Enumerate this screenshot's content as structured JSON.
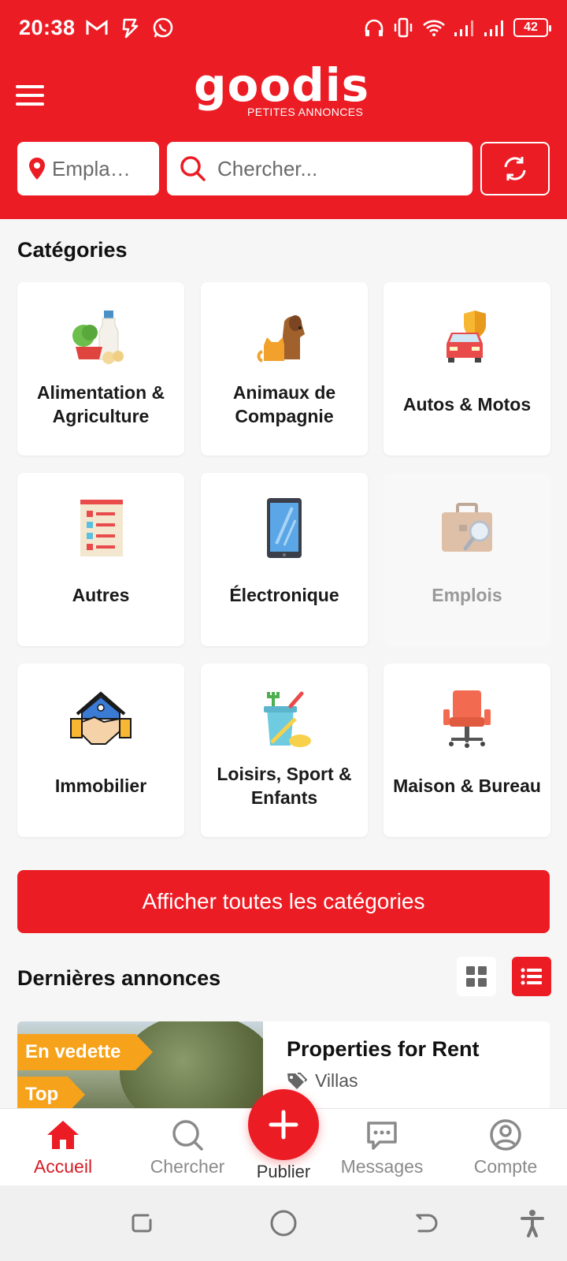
{
  "status_bar": {
    "time": "20:38",
    "battery": "42"
  },
  "header": {
    "logo_text": "goodis",
    "logo_subtitle": "PETITES ANNONCES"
  },
  "search": {
    "location_placeholder": "Empla…",
    "query_placeholder": "Chercher..."
  },
  "categories": {
    "title": "Catégories",
    "items": [
      {
        "label": "Alimentation & Agriculture",
        "icon": "food-icon"
      },
      {
        "label": "Animaux de Compagnie",
        "icon": "pets-icon"
      },
      {
        "label": "Autos & Motos",
        "icon": "car-icon"
      },
      {
        "label": "Autres",
        "icon": "list-icon"
      },
      {
        "label": "Électronique",
        "icon": "phone-icon"
      },
      {
        "label": "Emplois",
        "icon": "briefcase-icon"
      },
      {
        "label": "Immobilier",
        "icon": "house-handshake-icon"
      },
      {
        "label": "Loisirs, Sport & Enfants",
        "icon": "toys-icon"
      },
      {
        "label": "Maison & Bureau",
        "icon": "office-chair-icon"
      }
    ],
    "show_all_label": "Afficher toutes les catégories"
  },
  "latest": {
    "title": "Dernières annonces",
    "listing": {
      "title": "Properties for Rent",
      "category": "Villas",
      "badges": [
        "En vedette",
        "Top"
      ]
    }
  },
  "bottom_nav": {
    "items": [
      {
        "label": "Accueil",
        "icon": "home-icon",
        "active": true
      },
      {
        "label": "Chercher",
        "icon": "search-icon",
        "active": false
      },
      {
        "label": "Publier",
        "icon": "plus-icon",
        "active": false
      },
      {
        "label": "Messages",
        "icon": "chat-icon",
        "active": false
      },
      {
        "label": "Compte",
        "icon": "user-icon",
        "active": false
      }
    ]
  },
  "colors": {
    "brand": "#ec1c24",
    "badge": "#f7a21b",
    "background": "#f6f6f6"
  }
}
